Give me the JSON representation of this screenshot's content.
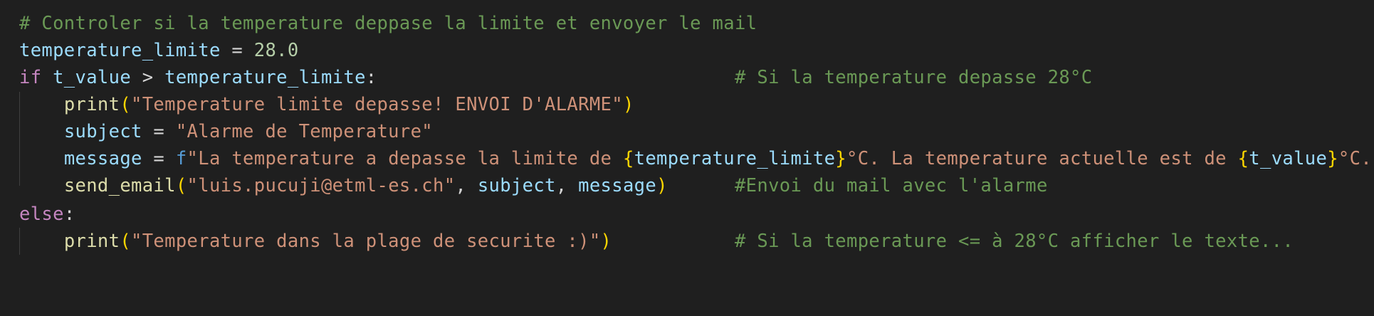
{
  "code": {
    "line1": {
      "comment": "# Controler si la temperature deppase la limite et envoyer le mail"
    },
    "line2": {
      "var": "temperature_limite",
      "op": " = ",
      "num": "28.0"
    },
    "line3": {
      "kw": "if",
      "sp1": " ",
      "var1": "t_value",
      "op": " > ",
      "var2": "temperature_limite",
      "colon": ":",
      "gap": "                                ",
      "comment": "# Si la temperature depasse 28°C"
    },
    "line4": {
      "indent": "    ",
      "fn": "print",
      "open": "(",
      "str": "\"Temperature limite depasse! ENVOI D'ALARME\"",
      "close": ")"
    },
    "line5": {
      "indent": "    ",
      "var": "subject",
      "op": " = ",
      "str": "\"Alarme de Temperature\""
    },
    "line6": {
      "indent": "    ",
      "var": "message",
      "op": " = ",
      "prefix": "f",
      "str1": "\"La temperature a depasse la limite de ",
      "br1o": "{",
      "var1": "temperature_limite",
      "br1c": "}",
      "str2": "°C. La temperature actuelle est de ",
      "br2o": "{",
      "var2": "t_value",
      "br2c": "}",
      "str3": "°C.\""
    },
    "line7": {
      "indent": "    ",
      "fn": "send_email",
      "open": "(",
      "str": "\"luis.pucuji@etml-es.ch\"",
      "comma1": ", ",
      "arg1": "subject",
      "comma2": ", ",
      "arg2": "message",
      "close": ")",
      "gap": "      ",
      "comment": "#Envoi du mail avec l'alarme"
    },
    "line8": {
      "kw": "else",
      "colon": ":"
    },
    "line9": {
      "indent": "    ",
      "fn": "print",
      "open": "(",
      "str": "\"Temperature dans la plage de securite :)\"",
      "close": ")",
      "gap": "           ",
      "comment": "# Si la temperature <= à 28°C afficher le texte..."
    }
  },
  "colors": {
    "background": "#1f1f1f",
    "comment": "#6a9955",
    "variable": "#9cdcfe",
    "keyword": "#c586c0",
    "function": "#dcdcaa",
    "string": "#ce9178",
    "number": "#b5cea8",
    "bracket": "#ffd700",
    "fprefix": "#569cd6"
  }
}
